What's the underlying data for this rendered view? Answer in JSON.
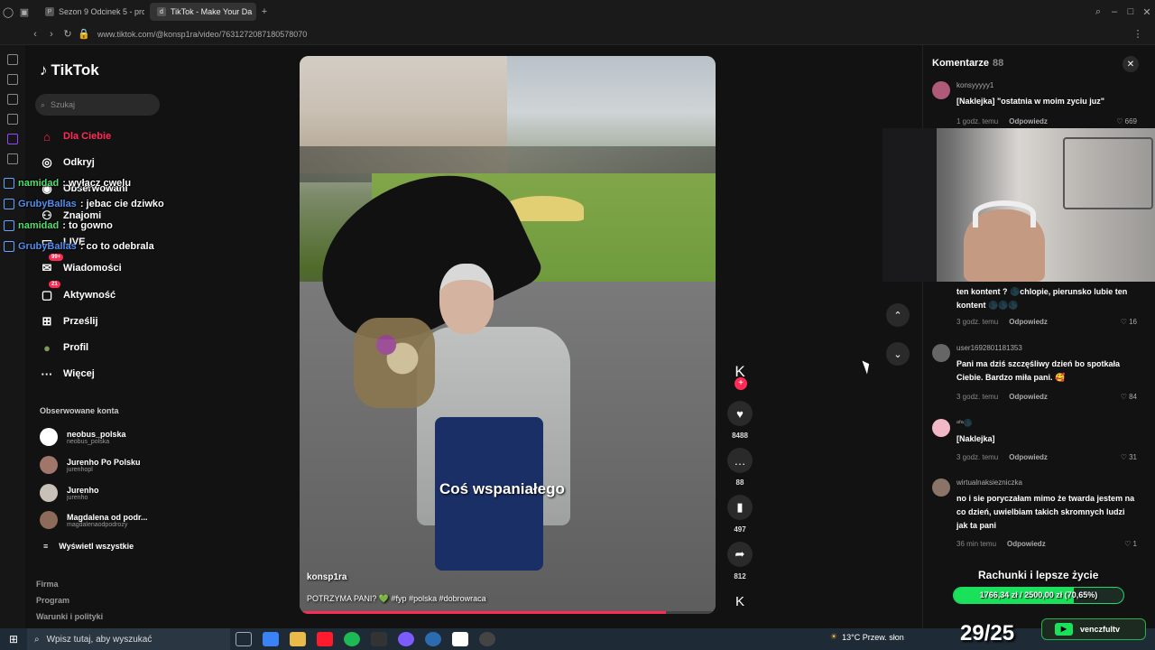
{
  "browser": {
    "tabs": [
      {
        "label": "Sezon 9 Odcinek 5 - prog",
        "favicon": "P"
      },
      {
        "label": "TikTok - Make Your Da",
        "favicon": "d"
      }
    ],
    "url": "www.tiktok.com/@konsp1ra/video/7631272087180578070"
  },
  "sidebar": {
    "logo": "TikTok",
    "search_placeholder": "Szukaj",
    "nav": [
      {
        "label": "Dla Ciebie",
        "icon": "home-icon",
        "badge": ""
      },
      {
        "label": "Odkryj",
        "icon": "compass-icon",
        "badge": ""
      },
      {
        "label": "Obserwowani",
        "icon": "user-avatar-icon",
        "badge": ""
      },
      {
        "label": "Znajomi",
        "icon": "friends-icon",
        "badge": ""
      },
      {
        "label": "LIVE",
        "icon": "live-icon",
        "badge": ""
      },
      {
        "label": "Wiadomości",
        "icon": "messages-icon",
        "badge": "99+"
      },
      {
        "label": "Aktywność",
        "icon": "activity-icon",
        "badge": "21"
      },
      {
        "label": "Prześlij",
        "icon": "upload-icon",
        "badge": ""
      },
      {
        "label": "Profil",
        "icon": "profile-icon",
        "badge": ""
      },
      {
        "label": "Więcej",
        "icon": "more-icon",
        "badge": ""
      }
    ],
    "followed_title": "Obserwowane konta",
    "followed": [
      {
        "name": "neobus_polska",
        "handle": "neobus_polska"
      },
      {
        "name": "Jurenho Po Polsku",
        "handle": "jurenhopl"
      },
      {
        "name": "Jurenho",
        "handle": "jurenho"
      },
      {
        "name": "Magdalena od podr...",
        "handle": "magdalenaodpodrozy"
      }
    ],
    "see_all": "Wyświetl wszystkie",
    "footer": [
      "Firma",
      "Program",
      "Warunki i polityki"
    ]
  },
  "chat_overlay": [
    {
      "user": "namidad",
      "text": ": wyłącz cwelu",
      "color": "#4ee06a"
    },
    {
      "user": "GrubyBallas",
      "text": ": jebac cie dziwko",
      "color": "#4f8ff0"
    },
    {
      "user": "namidad",
      "text": ": to gowno",
      "color": "#4ee06a"
    },
    {
      "user": "GrubyBallas",
      "text": ": co to odebrala",
      "color": "#4f8ff0"
    }
  ],
  "video": {
    "caption": "Coś wspaniałego",
    "author": "konsp1ra",
    "description": "POTRZYMA PANI? 💚 #fyp #polska #dobrowraca",
    "progress": 0.88
  },
  "actions": {
    "likes": "8488",
    "comments": "88",
    "saves": "497",
    "shares": "812"
  },
  "comments_panel": {
    "title": "Komentarze",
    "count": "88",
    "items": [
      {
        "user": "konsyyyyy1",
        "text": "[Naklejka] \"ostatnia w moim zyciu juz\"",
        "time": "1 godz. temu",
        "likes": "669",
        "avatar": "#b05a7a"
      },
      {
        "user": "",
        "text": "ten kontent ? 🌑chlopie, pierunsko lubie ten kontent 🌑🌑🌑",
        "time": "3 godz. temu",
        "likes": "16",
        "avatar": "#121212"
      },
      {
        "user": "user1692801181353",
        "text": "Pani ma dziś szczęśliwy dzień bo spotkała Ciebie. Bardzo miła pani. 🥰",
        "time": "3 godz. temu",
        "likes": "84",
        "avatar": "#666"
      },
      {
        "user": "ᵃᶠᵃ🌑",
        "text": "[Naklejka]",
        "time": "3 godz. temu",
        "likes": "31",
        "avatar": "#f2b8c6"
      },
      {
        "user": "wirtualnaksiezniczka",
        "text": "no i sie poryczałam mimo że twarda jestem na co dzień, uwielbiam takich skromnych ludzi jak ta pani",
        "time": "36 min temu",
        "likes": "1",
        "avatar": "#8a7468"
      }
    ],
    "reply_label": "Odpowiedz"
  },
  "stream": {
    "donation_title": "Rachunki i lepsze życie",
    "donation_progress": "1766,34 zł / 2500,00 zł (70,65%)",
    "donation_fraction": 0.7065,
    "sub_counter": "29/25",
    "channel": "venczfultv"
  },
  "taskbar": {
    "search_placeholder": "Wpisz tutaj, aby wyszukać",
    "weather": "13°C  Przew. słon"
  }
}
